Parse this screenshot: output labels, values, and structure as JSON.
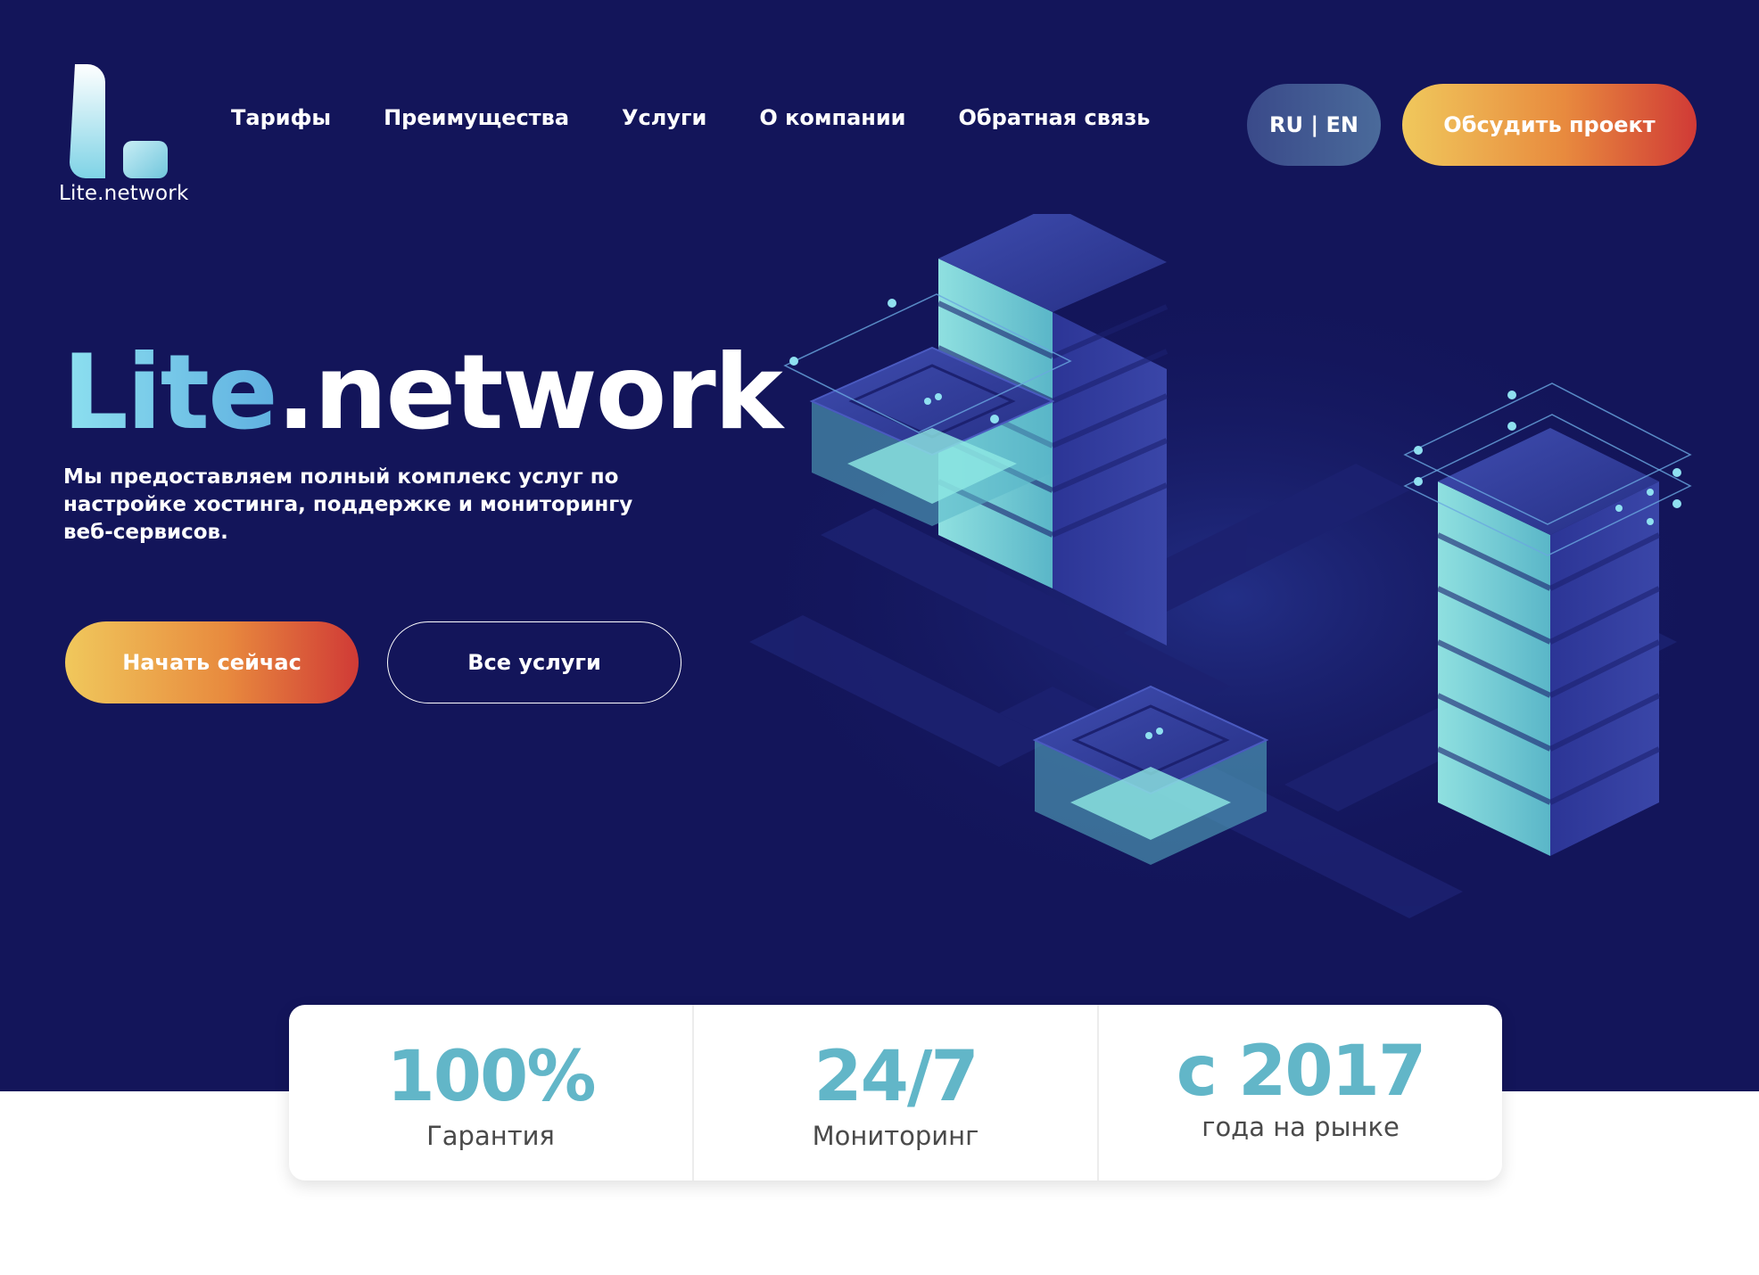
{
  "brand": {
    "logo_text": "Lite.network"
  },
  "nav": {
    "items": [
      "Тарифы",
      "Преимущества",
      "Услуги",
      "О компании",
      "Обратная связь"
    ]
  },
  "header": {
    "lang_label": "RU | EN",
    "cta_label": "Обсудить проект"
  },
  "hero": {
    "title_part1": "Lite",
    "title_part2": ".network",
    "description": "Мы предоставляем полный  комплекс услуг по настройке хостинга, поддержке и мониторингу веб-сервисов.",
    "start_button": "Начать сейчас",
    "services_button": "Все услуги"
  },
  "stats": [
    {
      "value": "100%",
      "label": "Гарантия"
    },
    {
      "value": "24/7",
      "label": "Мониторинг"
    },
    {
      "value": "с 2017",
      "label": "года на рынке"
    }
  ],
  "colors": {
    "hero_background": "#13155a",
    "accent_teal": "#62b6c8",
    "gradient_start": "#f0c85c",
    "gradient_end": "#d03a36"
  },
  "icons": {
    "logo": "L-logo-icon",
    "illustration": "isometric-servers-illustration"
  }
}
